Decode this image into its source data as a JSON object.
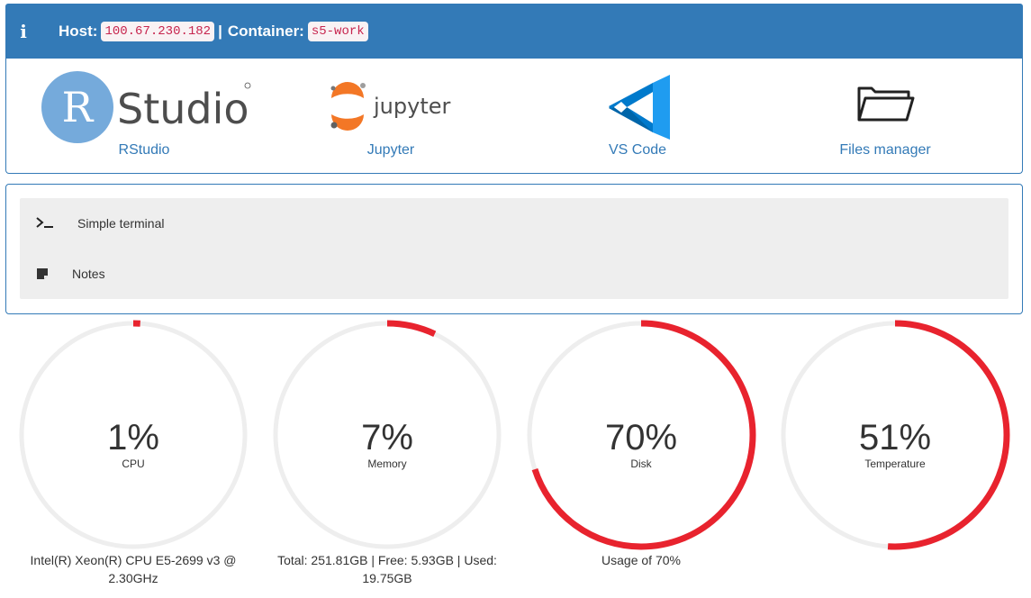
{
  "header": {
    "host_label": "Host:",
    "host_value": "100.67.230.182",
    "separator": "|",
    "container_label": "Container:",
    "container_value": "s5-work",
    "icon": "info-icon"
  },
  "apps": [
    {
      "label": "RStudio",
      "logo_letter": "R",
      "logo_word": "Studio",
      "icon": "rstudio-logo"
    },
    {
      "label": "Jupyter",
      "logo_word": "jupyter",
      "icon": "jupyter-logo"
    },
    {
      "label": "VS Code",
      "icon": "vscode-logo"
    },
    {
      "label": "Files manager",
      "icon": "folder-icon"
    }
  ],
  "tools": [
    {
      "label": "Simple terminal",
      "icon": "terminal-icon"
    },
    {
      "label": "Notes",
      "icon": "note-icon"
    }
  ],
  "gauges": [
    {
      "value_text": "1%",
      "value": 1,
      "label": "CPU",
      "description": "Intel(R) Xeon(R) CPU E5-2699 v3 @ 2.30GHz"
    },
    {
      "value_text": "7%",
      "value": 7,
      "label": "Memory",
      "description": "Total: 251.81GB | Free: 5.93GB | Used: 19.75GB"
    },
    {
      "value_text": "70%",
      "value": 70,
      "label": "Disk",
      "description": "Usage of 70%"
    },
    {
      "value_text": "51%",
      "value": 51,
      "label": "Temperature",
      "description": ""
    }
  ],
  "colors": {
    "primary": "#337ab7",
    "gauge_fill": "#e8232e",
    "gauge_track": "#eeeeee",
    "code_text": "#c7254e",
    "code_bg": "#f9f2f4",
    "rstudio_blue": "#75aadb",
    "jupyter_orange": "#f37726",
    "vscode_blue": "#0065a9"
  }
}
